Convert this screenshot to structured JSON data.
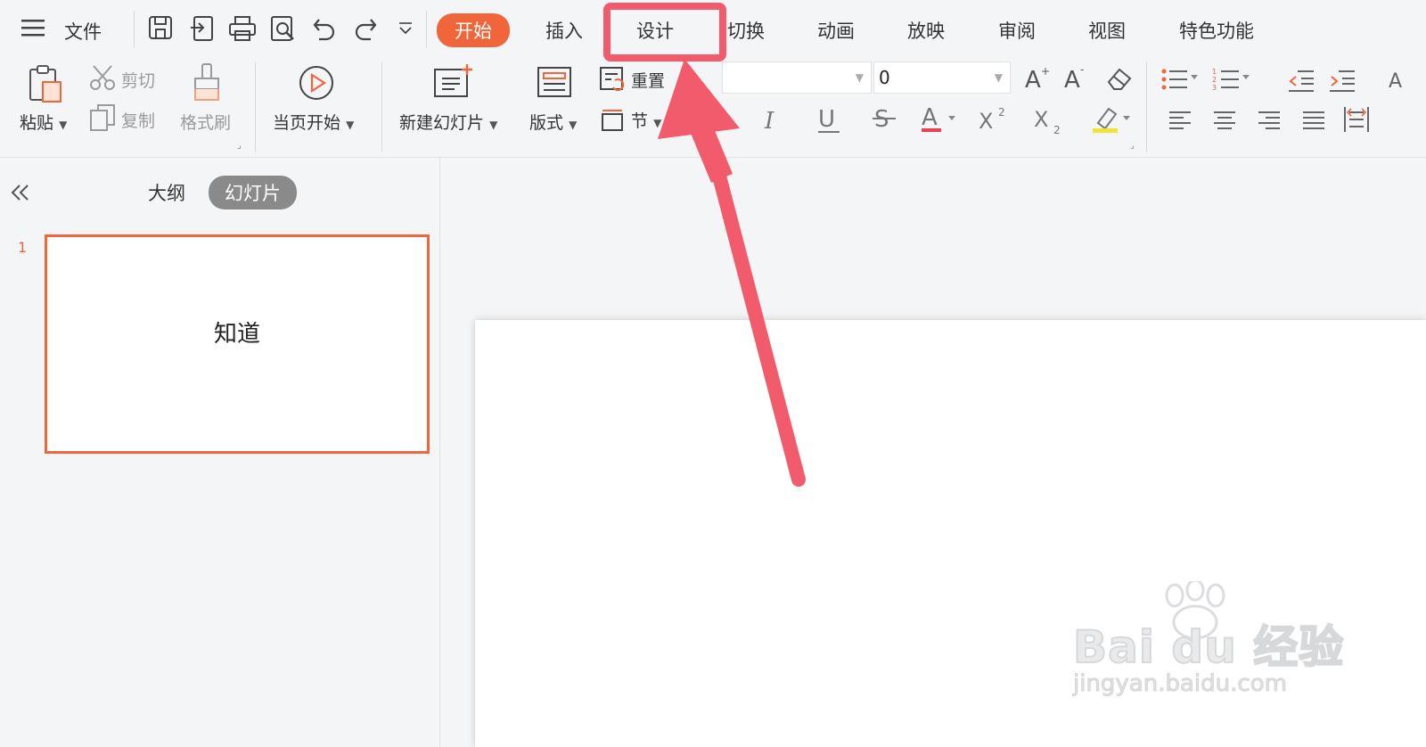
{
  "menubar": {
    "file_label": "文件",
    "tabs": [
      {
        "label": "开始",
        "active": true
      },
      {
        "label": "插入"
      },
      {
        "label": "设计"
      },
      {
        "label": "切换"
      },
      {
        "label": "动画"
      },
      {
        "label": "放映"
      },
      {
        "label": "审阅"
      },
      {
        "label": "视图"
      },
      {
        "label": "特色功能"
      }
    ]
  },
  "toolbar": {
    "paste": "粘贴",
    "cut": "剪切",
    "copy": "复制",
    "format_painter": "格式刷",
    "play_from_current": "当页开始",
    "new_slide": "新建幻灯片",
    "layout": "版式",
    "reset": "重置",
    "section": "节",
    "font_size_value": "0"
  },
  "left_panel": {
    "outline_tab": "大纲",
    "slides_tab": "幻灯片",
    "slide_number": "1",
    "slide_text": "知道"
  },
  "watermark": {
    "brand": "Bai du 经验",
    "url": "jingyan.baidu.com"
  },
  "colors": {
    "accent": "#f0663a",
    "annotation": "#f25b6c"
  }
}
